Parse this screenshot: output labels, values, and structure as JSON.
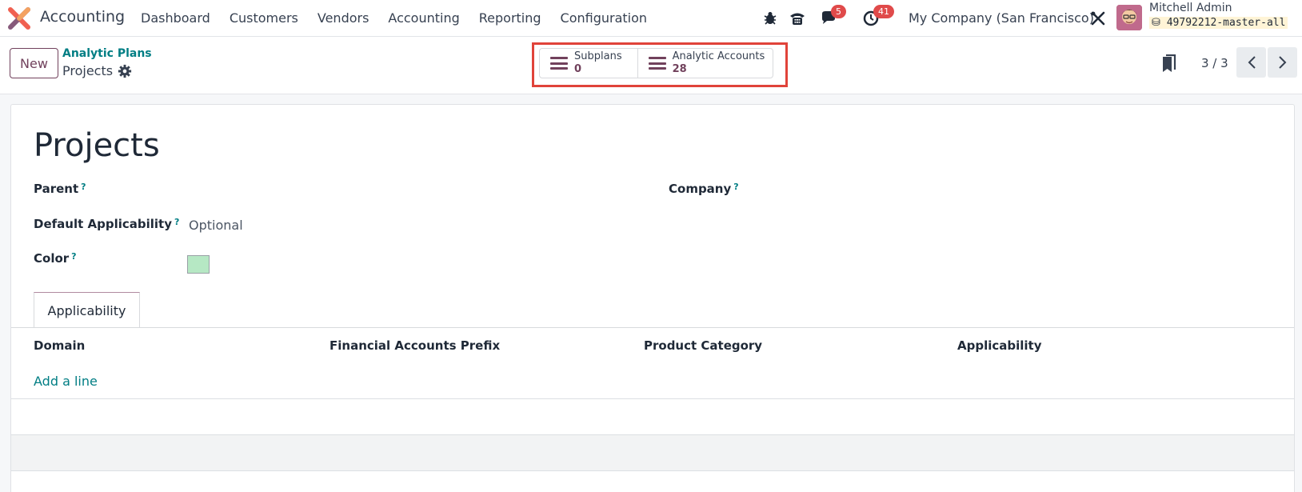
{
  "app": {
    "name": "Accounting",
    "logo_icon": "odoo-accounting-icon"
  },
  "menu": [
    "Dashboard",
    "Customers",
    "Vendors",
    "Accounting",
    "Reporting",
    "Configuration"
  ],
  "systray": {
    "chat_badge": "5",
    "activity_badge": "41",
    "company": "My Company (San Francisco)",
    "user_name": "Mitchell Admin",
    "database": "49792212-master-all"
  },
  "control": {
    "new_label": "New",
    "breadcrumb_parent": "Analytic Plans",
    "breadcrumb_current": "Projects",
    "smart_buttons": [
      {
        "label": "Subplans",
        "value": "0"
      },
      {
        "label": "Analytic Accounts",
        "value": "28"
      }
    ],
    "pager": "3 / 3"
  },
  "form": {
    "title": "Projects",
    "fields": {
      "parent_label": "Parent",
      "company_label": "Company",
      "applicability_label": "Default Applicability",
      "applicability_value": "Optional",
      "color_label": "Color",
      "color_value": "#b6e8c4",
      "help_mark": "?"
    },
    "tab_label": "Applicability",
    "columns": [
      "Domain",
      "Financial Accounts Prefix",
      "Product Category",
      "Applicability"
    ],
    "add_line": "Add a line"
  },
  "colors": {
    "brand": "#71415c",
    "link": "#017e84",
    "badge": "#e04a4a",
    "highlight": "#e0433a"
  }
}
